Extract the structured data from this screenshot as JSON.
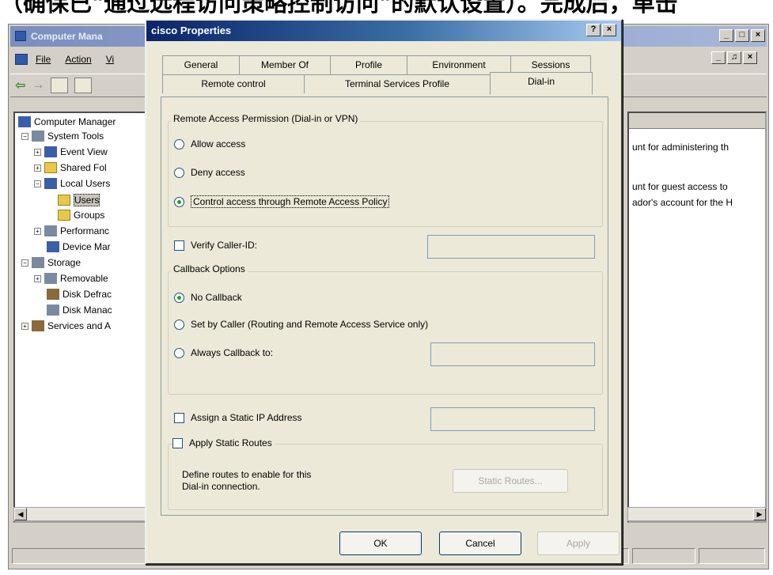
{
  "caption": "（确保已\"通过远程访问策略控制访问\"的默认设置）。完成后，单击",
  "mmc": {
    "title": "Computer Mana",
    "window_buttons": [
      "_",
      "□",
      "×"
    ],
    "child_buttons": [
      "_",
      "♫",
      "×"
    ],
    "menu": [
      "File",
      "Action",
      "Vi"
    ],
    "tree": [
      {
        "label": "Computer Manager"
      },
      {
        "label": "System Tools"
      },
      {
        "label": "Event View"
      },
      {
        "label": "Shared Fol"
      },
      {
        "label": "Local Users"
      },
      {
        "label": "Users"
      },
      {
        "label": "Groups"
      },
      {
        "label": "Performanc"
      },
      {
        "label": "Device Mar"
      },
      {
        "label": "Storage"
      },
      {
        "label": "Removable"
      },
      {
        "label": "Disk Defrac"
      },
      {
        "label": "Disk Manac"
      },
      {
        "label": "Services and A"
      }
    ],
    "right_rows": [
      "unt for administering th",
      "unt for guest access to",
      "ador's account for the H"
    ]
  },
  "dialog": {
    "title": "cisco Properties",
    "help_button": "?",
    "close_button": "×",
    "tabs_row1": [
      "General",
      "Member Of",
      "Profile",
      "Environment",
      "Sessions"
    ],
    "tabs_row2": [
      "Remote control",
      "Terminal Services Profile",
      "Dial-in"
    ],
    "remote_access_group": "Remote Access Permission (Dial-in or VPN)",
    "allow_access": "Allow access",
    "deny_access": "Deny access",
    "control_access": "Control access through Remote Access Policy",
    "verify_caller_id": "Verify Caller-ID:",
    "callback_group": "Callback Options",
    "no_callback": "No Callback",
    "set_by_caller": "Set by Caller (Routing and Remote Access Service only)",
    "always_callback": "Always Callback to:",
    "assign_static_ip": "Assign a Static IP Address",
    "apply_static_routes": "Apply Static Routes",
    "routes_description": "Define routes to enable for this Dial-in connection.",
    "static_routes_button": "Static Routes...",
    "ok_button": "OK",
    "cancel_button": "Cancel",
    "apply_button": "Apply"
  }
}
